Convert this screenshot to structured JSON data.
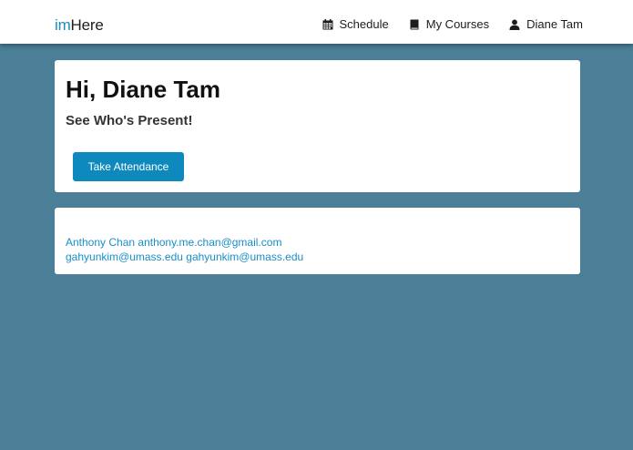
{
  "brand": {
    "prefix": "im",
    "rest": "Here"
  },
  "nav": {
    "items": [
      {
        "label": "Schedule",
        "icon": "calendar-icon"
      },
      {
        "label": "My Courses",
        "icon": "book-icon"
      },
      {
        "label": "Diane Tam",
        "icon": "user-icon"
      }
    ]
  },
  "hero": {
    "title": "Hi, Diane Tam",
    "subtitle": "See Who's Present!",
    "button_label": "Take Attendance"
  },
  "students": [
    {
      "name": "Anthony Chan",
      "email": "anthony.me.chan@gmail.com"
    },
    {
      "name": "gahyunkim@umass.edu",
      "email": "gahyunkim@umass.edu"
    }
  ],
  "colors": {
    "background": "#4a7f97",
    "accent": "#0e89bd",
    "link": "#1a8ec8"
  }
}
